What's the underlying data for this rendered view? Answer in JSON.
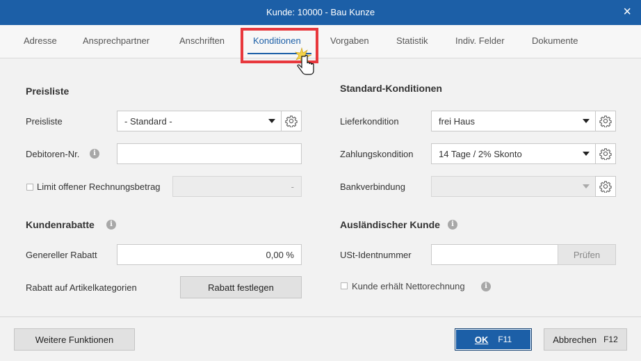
{
  "window": {
    "title": "Kunde: 10000 - Bau Kunze",
    "close_icon": "×"
  },
  "tabs": [
    {
      "label": "Adresse"
    },
    {
      "label": "Ansprechpartner"
    },
    {
      "label": "Anschriften"
    },
    {
      "label": "Konditionen",
      "active": true
    },
    {
      "label": "Vorgaben"
    },
    {
      "label": "Statistik"
    },
    {
      "label": "Indiv. Felder"
    },
    {
      "label": "Dokumente"
    }
  ],
  "left": {
    "preisliste_heading": "Preisliste",
    "preisliste_label": "Preisliste",
    "preisliste_value": "- Standard -",
    "debitoren_label": "Debitoren-Nr.",
    "debitoren_value": "",
    "limit_label": "Limit offener Rechnungsbetrag",
    "limit_value": "-",
    "kundenrabatte_heading": "Kundenrabatte",
    "rabatt_label": "Genereller Rabatt",
    "rabatt_value": "0,00 %",
    "artikelkategorien_label": "Rabatt auf Artikelkategorien",
    "rabatt_button": "Rabatt festlegen"
  },
  "right": {
    "standard_heading": "Standard-Konditionen",
    "liefer_label": "Lieferkondition",
    "liefer_value": "frei Haus",
    "zahlung_label": "Zahlungskondition",
    "zahlung_value": "14 Tage / 2% Skonto",
    "bank_label": "Bankverbindung",
    "bank_value": "",
    "auslaendisch_heading": "Ausländischer Kunde",
    "ust_label": "USt-Identnummer",
    "ust_value": "",
    "pruefen_button": "Prüfen",
    "netto_label": "Kunde erhält Nettorechnung"
  },
  "footer": {
    "weitere_label": "Weitere Funktionen",
    "ok_label": "OK",
    "ok_shortcut": "F11",
    "abbrechen_label": "Abbrechen",
    "abbrechen_shortcut": "F12"
  },
  "colors": {
    "titlebar": "#1c5fa7",
    "accent": "#1c5fa7",
    "highlight": "#e8383d"
  },
  "icons": {
    "gear": "gear-icon",
    "info": "info-icon",
    "dropdown": "chevron-down-icon",
    "cursor": "hand-pointer-icon"
  }
}
